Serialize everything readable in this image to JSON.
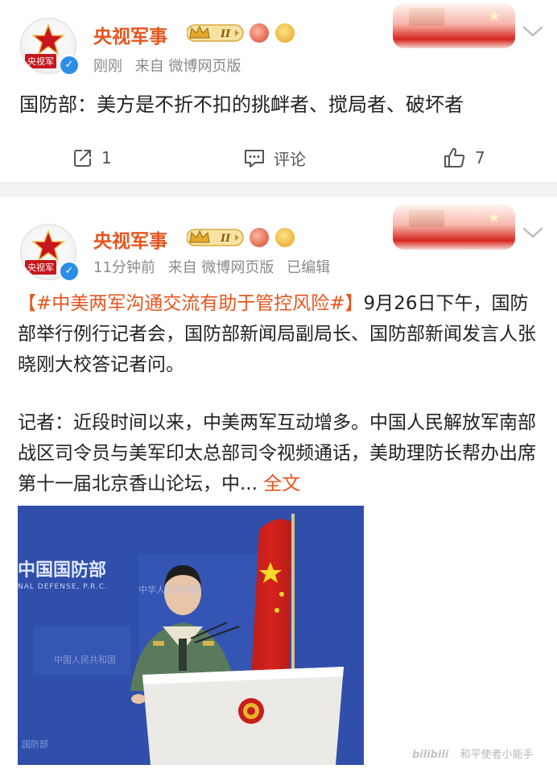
{
  "colors": {
    "accent": "#e8541e",
    "meta_gray": "#8a8a8a",
    "text": "#222222",
    "separator": "#f2f2f2",
    "verified_blue": "#2b8ee6"
  },
  "post1": {
    "author": "央视军事",
    "avatar_label": "央视军",
    "badge_text": "II",
    "time": "刚刚",
    "source": "来自 微博网页版",
    "title": "国防部：美方是不折不扣的挑衅者、搅局者、破坏者",
    "actions": {
      "share_count": "1",
      "comment_label": "评论",
      "like_count": "7"
    },
    "icons": [
      "avatar",
      "verified-icon",
      "crown-badge-icon",
      "medal-badge-icon",
      "smiley-badge-icon",
      "banner-image",
      "chevron-down-icon",
      "share-icon",
      "comment-icon",
      "like-icon"
    ]
  },
  "post2": {
    "author": "央视军事",
    "avatar_label": "央视军",
    "badge_text": "II",
    "time": "11分钟前",
    "source": "来自 微博网页版",
    "edited": "已编辑",
    "hashtag": "【#中美两军沟通交流有助于管控风险#】",
    "para1_rest": "9月26日下午，国防部举行例行记者会，国防部新闻局副局长、国防部新闻发言人张晓刚大校答记者问。",
    "para2": "记者：近段时间以来，中美两军互动增多。中国人民解放军南部战区司令员与美军印太总部司令视频通话，美助理防长帮办出席第十一届北京香山论坛，中...",
    "full_text_link": " 全文",
    "photo": {
      "wall_text": "中国国防部",
      "wall_sub": "NAL DEFENSE, P.R.C."
    }
  },
  "watermark": {
    "logo": "bilibili",
    "text": "和平使者小能手"
  }
}
